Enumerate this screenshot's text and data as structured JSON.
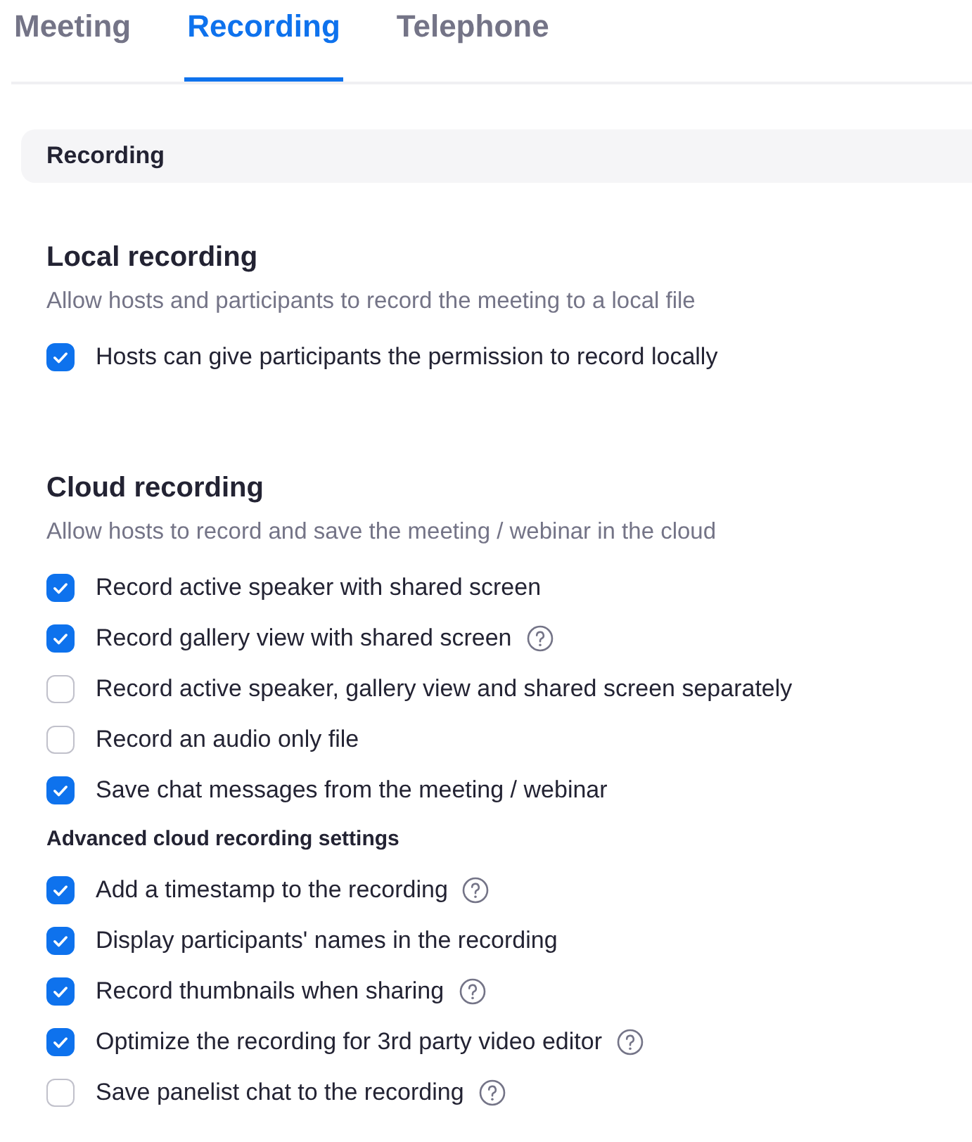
{
  "tabs": [
    {
      "label": "Meeting",
      "selected": false
    },
    {
      "label": "Recording",
      "selected": true
    },
    {
      "label": "Telephone",
      "selected": false
    }
  ],
  "section_header": "Recording",
  "groups": [
    {
      "title": "Local recording",
      "description": "Allow hosts and participants to record the meeting to a local file",
      "items": [
        {
          "label": "Hosts can give participants the permission to record locally",
          "checked": true,
          "help": false
        }
      ]
    },
    {
      "title": "Cloud recording",
      "description": "Allow hosts to record and save the meeting / webinar in the cloud",
      "items": [
        {
          "label": "Record active speaker with shared screen",
          "checked": true,
          "help": false
        },
        {
          "label": "Record gallery view with shared screen",
          "checked": true,
          "help": true
        },
        {
          "label": "Record active speaker, gallery view and shared screen separately",
          "checked": false,
          "help": false
        },
        {
          "label": "Record an audio only file",
          "checked": false,
          "help": false
        },
        {
          "label": "Save chat messages from the meeting / webinar",
          "checked": true,
          "help": false
        }
      ],
      "subsection": "Advanced cloud recording settings",
      "sub_items": [
        {
          "label": "Add a timestamp to the recording",
          "checked": true,
          "help": true
        },
        {
          "label": "Display participants' names in the recording",
          "checked": true,
          "help": false
        },
        {
          "label": "Record thumbnails when sharing",
          "checked": true,
          "help": true
        },
        {
          "label": "Optimize the recording for 3rd party video editor",
          "checked": true,
          "help": true
        },
        {
          "label": "Save panelist chat to the recording",
          "checked": false,
          "help": true
        }
      ]
    }
  ]
}
